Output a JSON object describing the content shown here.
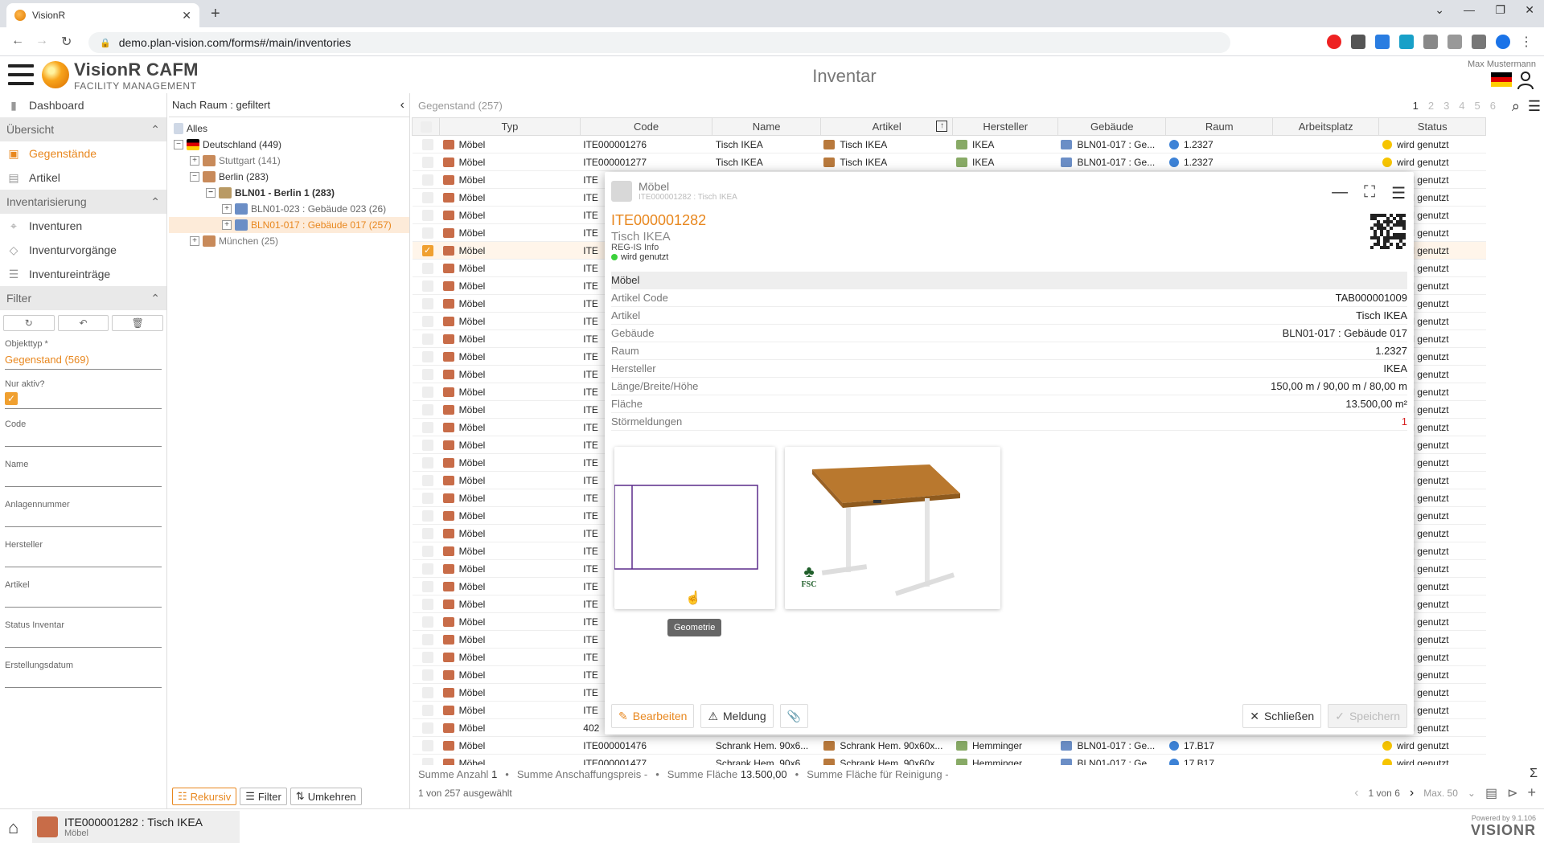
{
  "browser": {
    "tab_title": "VisionR",
    "url": "demo.plan-vision.com/forms#/main/inventories"
  },
  "header": {
    "brand_line1": "VisionR CAFM",
    "brand_line2": "FACILITY MANAGEMENT",
    "page_title": "Inventar",
    "user": "Max Mustermann"
  },
  "sidebar": {
    "dashboard": "Dashboard",
    "sections": {
      "overview": "Übersicht",
      "inventory": "Inventarisierung",
      "filter": "Filter"
    },
    "items": {
      "gegenstaende": "Gegenstände",
      "artikel": "Artikel",
      "inventuren": "Inventuren",
      "inventurvorgaenge": "Inventurvorgänge",
      "inventureintraege": "Inventureinträge"
    },
    "filters": {
      "objekttyp_label": "Objekttyp *",
      "objekttyp_value": "Gegenstand (569)",
      "nur_aktiv_label": "Nur aktiv?",
      "code": "Code",
      "name": "Name",
      "anlagennummer": "Anlagennummer",
      "hersteller": "Hersteller",
      "artikel": "Artikel",
      "status_inventar": "Status Inventar",
      "erstellungsdatum": "Erstellungsdatum"
    }
  },
  "tree": {
    "header": "Nach Raum : gefiltert",
    "nodes": [
      {
        "label": "Alles"
      },
      {
        "label": "Deutschland (449)"
      },
      {
        "label": "Stuttgart (141)"
      },
      {
        "label": "Berlin (283)"
      },
      {
        "label": "BLN01 - Berlin 1 (283)"
      },
      {
        "label": "BLN01-023 : Gebäude 023 (26)"
      },
      {
        "label": "BLN01-017 : Gebäude 017 (257)"
      },
      {
        "label": "München (25)"
      }
    ],
    "buttons": {
      "rekursiv": "Rekursiv",
      "filter": "Filter",
      "umkehren": "Umkehren"
    }
  },
  "list": {
    "title": "Gegenstand (257)",
    "pages": [
      "1",
      "2",
      "3",
      "4",
      "5",
      "6"
    ],
    "columns": [
      "Typ",
      "Code",
      "Name",
      "Artikel",
      "Hersteller",
      "Gebäude",
      "Raum",
      "Arbeitsplatz",
      "Status"
    ],
    "row_type": "Möbel",
    "status": "wird genutzt",
    "first_rows": [
      {
        "code": "ITE000001276",
        "name": "Tisch IKEA",
        "artikel": "Tisch IKEA",
        "hersteller": "IKEA",
        "gebaeude": "BLN01-017 : Ge...",
        "raum": "1.2327"
      },
      {
        "code": "ITE000001277",
        "name": "Tisch IKEA",
        "artikel": "Tisch IKEA",
        "hersteller": "IKEA",
        "gebaeude": "BLN01-017 : Ge...",
        "raum": "1.2327"
      }
    ],
    "hidden_code_prefix": "ITE",
    "row_402": "402",
    "last_rows": [
      {
        "code": "ITE000001476",
        "name": "Schrank Hem. 90x6...",
        "artikel": "Schrank Hem. 90x60x...",
        "hersteller": "Hemminger",
        "gebaeude": "BLN01-017 : Ge...",
        "raum": "17.B17"
      },
      {
        "code": "ITE000001477",
        "name": "Schrank Hem. 90x6...",
        "artikel": "Schrank Hem. 90x60x...",
        "hersteller": "Hemminger",
        "gebaeude": "BLN01-017 : Ge...",
        "raum": "17.B17"
      }
    ],
    "summary": {
      "anzahl_label": "Summe Anzahl",
      "anzahl_value": "1",
      "anschaffung": "Summe Anschaffungspreis -",
      "flaeche_label": "Summe Fläche",
      "flaeche_value": "13.500,00",
      "reinigung": "Summe Fläche für Reinigung -"
    },
    "selected_info": "1 von 257 ausgewählt",
    "page_info": "1 von 6",
    "max_label": "Max. 50"
  },
  "dialog": {
    "type": "Möbel",
    "subtitle": "ITE000001282 : Tisch IKEA",
    "code": "ITE000001282",
    "name": "Tisch IKEA",
    "reg": "REG-IS Info",
    "status": "wird genutzt",
    "properties": [
      {
        "k": "Möbel",
        "v": ""
      },
      {
        "k": "Artikel Code",
        "v": "TAB000001009"
      },
      {
        "k": "Artikel",
        "v": "Tisch IKEA"
      },
      {
        "k": "Gebäude",
        "v": "BLN01-017 : Gebäude 017"
      },
      {
        "k": "Raum",
        "v": "1.2327"
      },
      {
        "k": "Hersteller",
        "v": "IKEA"
      },
      {
        "k": "Länge/Breite/Höhe",
        "v": "150,00 m / 90,00 m / 80,00 m"
      },
      {
        "k": "Fläche",
        "v": "13.500,00 m²"
      },
      {
        "k": "Störmeldungen",
        "v": "1"
      }
    ],
    "tooltip": "Geometrie",
    "fsc": "FSC",
    "buttons": {
      "edit": "Bearbeiten",
      "meldung": "Meldung",
      "close": "Schließen",
      "save": "Speichern"
    }
  },
  "bottom": {
    "tab_title": "ITE000001282 : Tisch IKEA",
    "tab_sub": "Möbel",
    "powered": "Powered by",
    "version": "9.1.106",
    "brand": "VISIONR"
  }
}
